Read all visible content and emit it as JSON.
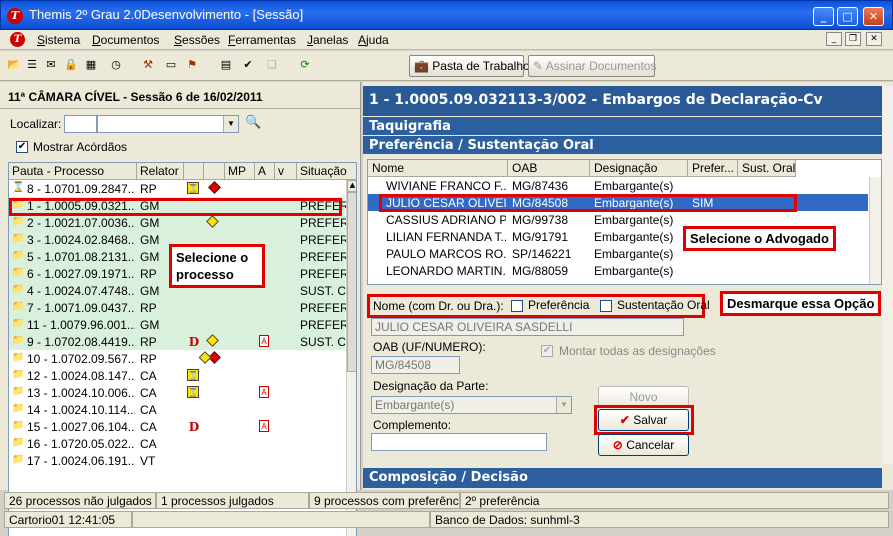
{
  "window": {
    "title": "Themis 2º Grau 2.0Desenvolvimento - [Sessão]",
    "minimize": "_",
    "maximize": "□",
    "close": "✕"
  },
  "menu": [
    "Sistema",
    "Documentos",
    "Sessões",
    "Ferramentas",
    "Janelas",
    "Ajuda"
  ],
  "toolbar": {
    "pasta_label": "Pasta de Trabalho",
    "assinar_label": "Assinar Documentos"
  },
  "left": {
    "session_title": "11ª CÂMARA CÍVEL - Sessão 6 de 16/02/2011",
    "localizar_label": "Localizar:",
    "mostrar_label": "Mostrar Acórdãos",
    "columns": [
      "Pauta - Processo",
      "Relator",
      "",
      "",
      "MP",
      "A",
      "v",
      "Situação"
    ],
    "rows": [
      {
        "proc": "8 - 1.0701.09.2847...",
        "relator": "RP",
        "situacao": ""
      },
      {
        "proc": "1 - 1.0005.09.0321...",
        "relator": "GM",
        "situacao": "PREFER"
      },
      {
        "proc": "2 - 1.0021.07.0036...",
        "relator": "GM",
        "situacao": "PREFER"
      },
      {
        "proc": "3 - 1.0024.02.8468...",
        "relator": "GM",
        "situacao": "PREFER"
      },
      {
        "proc": "5 - 1.0701.08.2131...",
        "relator": "GM",
        "situacao": "PREFER"
      },
      {
        "proc": "6 - 1.0027.09.1971...",
        "relator": "RP",
        "situacao": "PREFER"
      },
      {
        "proc": "4 - 1.0024.07.4748...",
        "relator": "GM",
        "situacao": "SUST. C"
      },
      {
        "proc": "7 - 1.0071.09.0437...",
        "relator": "RP",
        "situacao": "PREFER"
      },
      {
        "proc": "11 - 1.0079.96.001...",
        "relator": "GM",
        "situacao": "PREFER"
      },
      {
        "proc": "9 - 1.0702.08.4419...",
        "relator": "RP",
        "situacao": "SUST. C"
      },
      {
        "proc": "10 - 1.0702.09.567...",
        "relator": "RP",
        "situacao": ""
      },
      {
        "proc": "12 - 1.0024.08.147...",
        "relator": "CA",
        "situacao": ""
      },
      {
        "proc": "13 - 1.0024.10.006...",
        "relator": "CA",
        "situacao": ""
      },
      {
        "proc": "14 - 1.0024.10.114...",
        "relator": "CA",
        "situacao": ""
      },
      {
        "proc": "15 - 1.0027.06.104...",
        "relator": "CA",
        "situacao": ""
      },
      {
        "proc": "16 - 1.0720.05.022...",
        "relator": "CA",
        "situacao": ""
      },
      {
        "proc": "17 - 1.0024.06.191...",
        "relator": "VT",
        "situacao": ""
      }
    ],
    "mark_d": "D",
    "mark_a": "A",
    "annotation": "Selecione o\nprocesso"
  },
  "right": {
    "header": "1   -   1.0005.09.032113-3/002 - Embargos de Declaração-Cv",
    "taquigrafia": "Taquigrafia",
    "pref_section": "Preferência / Sustentação Oral",
    "adv_columns": [
      "Nome",
      "OAB",
      "Designação",
      "Prefer...",
      "Sust. Oral"
    ],
    "advogados": [
      {
        "nome": "WIVIANE FRANCO F...",
        "oab": "MG/87436",
        "designacao": "Embargante(s)",
        "pref": ""
      },
      {
        "nome": "JULIO CESAR OLIVEI...",
        "oab": "MG/84508",
        "designacao": "Embargante(s)",
        "pref": "SIM"
      },
      {
        "nome": "CASSIUS ADRIANO P...",
        "oab": "MG/99738",
        "designacao": "Embargante(s)",
        "pref": ""
      },
      {
        "nome": "LILIAN FERNANDA T...",
        "oab": "MG/91791",
        "designacao": "Embargante(s)",
        "pref": ""
      },
      {
        "nome": "PAULO MARCOS RO...",
        "oab": "SP/146221",
        "designacao": "Embargante(s)",
        "pref": ""
      },
      {
        "nome": "LEONARDO MARTIN...",
        "oab": "MG/88059",
        "designacao": "Embargante(s)",
        "pref": ""
      }
    ],
    "annotation_adv": "Selecione o Advogado",
    "nome_label": "Nome (com Dr. ou Dra.):",
    "preferencia_label": "Preferência",
    "sustentacao_label": "Sustentação Oral",
    "annotation_opt": "Desmarque essa Opção",
    "nome_value": "JULIO CESAR OLIVEIRA SASDELLI",
    "oab_label": "OAB (UF/NUMERO):",
    "oab_value": "MG/84508",
    "montar_label": "Montar todas as designações",
    "designacao_label": "Designação da Parte:",
    "designacao_value": "Embargante(s)",
    "complemento_label": "Complemento:",
    "complemento_value": "",
    "novo_label": "Novo",
    "salvar_label": "Salvar",
    "cancelar_label": "Cancelar",
    "composicao": "Composição / Decisão"
  },
  "status": {
    "nao_julgados": "26 processos não julgados",
    "julgados": "1 processos julgados",
    "preferencia": "9 processos com preferênci",
    "segunda": "2º preferência",
    "usuario": "Cartorio01",
    "hora": "12:41:05",
    "banco": "Banco de Dados: sunhml-3"
  },
  "colors": {
    "titlebar": "#0a53d8",
    "section": "#2c5f9e",
    "selection": "#316ac5",
    "annotation": "#e00000",
    "pref_row": "#d8f0dc"
  }
}
